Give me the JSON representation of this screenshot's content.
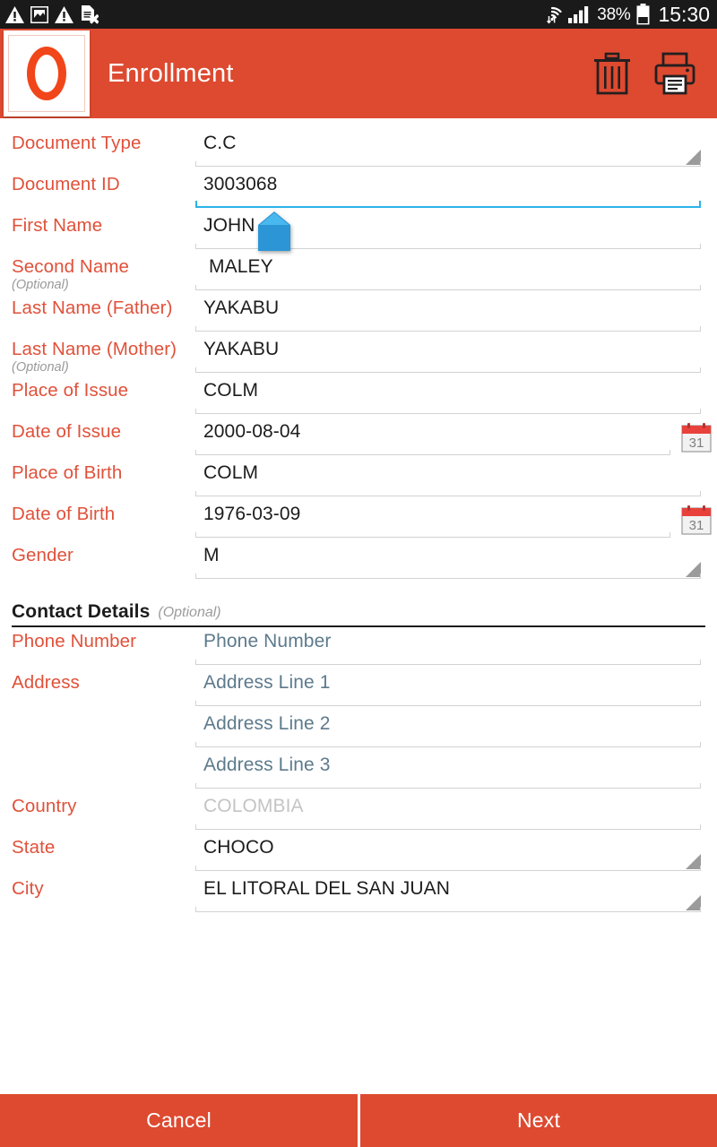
{
  "status_bar": {
    "icons_left": [
      "warning-triangle-icon",
      "photo-icon",
      "warning-triangle-icon",
      "sim-card-error-icon"
    ],
    "wifi_icon": "wifi-transfer-icon",
    "signal_icon": "cellular-signal-icon",
    "battery_percent": "38%",
    "battery_icon": "battery-icon",
    "clock": "15:30",
    "background": "#1a1a1a"
  },
  "app_bar": {
    "logo_name": "app-logo-o",
    "title": "Enrollment",
    "background": "#dd4a30",
    "actions": [
      {
        "name": "delete-button",
        "icon": "trash-icon"
      },
      {
        "name": "print-button",
        "icon": "printer-icon"
      }
    ]
  },
  "form": {
    "label_color": "#e0513a",
    "focus_color": "#2bb3e8",
    "fields": [
      {
        "label": "Document Type",
        "optional": "",
        "value": "C.C",
        "type": "spinner"
      },
      {
        "label": "Document ID",
        "optional": "",
        "value": "3003068",
        "type": "text",
        "focused": true
      },
      {
        "label": "First Name",
        "optional": "",
        "value": "JOHN",
        "type": "text"
      },
      {
        "label": "Second Name",
        "optional": "(Optional)",
        "value": "MALEY",
        "type": "text"
      },
      {
        "label": "Last Name (Father)",
        "optional": "",
        "value": "YAKABU",
        "type": "text"
      },
      {
        "label": "Last Name (Mother)",
        "optional": "(Optional)",
        "value": "YAKABU",
        "type": "text"
      },
      {
        "label": "Place of Issue",
        "optional": "",
        "value": "COLM",
        "type": "text"
      },
      {
        "label": "Date of Issue",
        "optional": "",
        "value": "2000-08-04",
        "type": "date"
      },
      {
        "label": "Place of Birth",
        "optional": "",
        "value": "COLM",
        "type": "text"
      },
      {
        "label": "Date of Birth",
        "optional": "",
        "value": "1976-03-09",
        "type": "date"
      },
      {
        "label": "Gender",
        "optional": "",
        "value": "M",
        "type": "spinner"
      }
    ],
    "section": {
      "title": "Contact Details",
      "optional": "(Optional)"
    },
    "contact_fields": [
      {
        "label": "Phone Number",
        "placeholder": "Phone Number",
        "value": "",
        "type": "text"
      },
      {
        "label": "Address",
        "placeholder": "Address Line 1",
        "value": "",
        "type": "text"
      },
      {
        "label": "",
        "placeholder": "Address Line 2",
        "value": "",
        "type": "text"
      },
      {
        "label": "",
        "placeholder": "Address Line 3",
        "value": "",
        "type": "text"
      },
      {
        "label": "Country",
        "placeholder": "COLOMBIA",
        "value": "",
        "type": "disabled"
      },
      {
        "label": "State",
        "placeholder": "",
        "value": "CHOCO",
        "type": "spinner"
      },
      {
        "label": "City",
        "placeholder": "",
        "value": "EL LITORAL DEL SAN JUAN",
        "type": "spinner"
      }
    ],
    "cursor_handle": "text-cursor-handle"
  },
  "footer": {
    "cancel_label": "Cancel",
    "next_label": "Next",
    "background": "#dd4a30"
  }
}
